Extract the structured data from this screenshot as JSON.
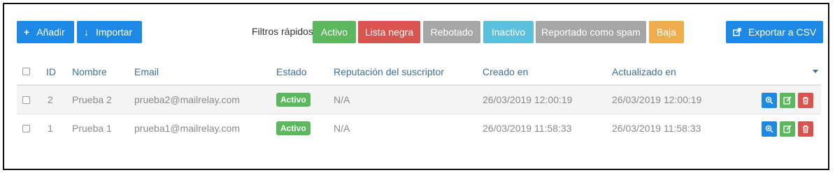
{
  "toolbar": {
    "add_label": "Añadir",
    "import_label": "Importar",
    "filters_label": "Filtros rápidos",
    "filters": [
      {
        "label": "Activo",
        "color": "#5cb85c"
      },
      {
        "label": "Lista negra",
        "color": "#d9534f"
      },
      {
        "label": "Rebotado",
        "color": "#a6a6a6"
      },
      {
        "label": "Inactivo",
        "color": "#5bc0de"
      },
      {
        "label": "Reportado como spam",
        "color": "#a6a6a6"
      },
      {
        "label": "Baja",
        "color": "#f0ad4e"
      }
    ],
    "export_label": "Exportar a CSV"
  },
  "table": {
    "headers": {
      "id": "ID",
      "name": "Nombre",
      "email": "Email",
      "status": "Estado",
      "reputation": "Reputación del suscriptor",
      "created": "Creado en",
      "updated": "Actualizado en"
    },
    "rows": [
      {
        "id": "2",
        "name": "Prueba 2",
        "email": "prueba2@mailrelay.com",
        "status": "Activo",
        "reputation": "N/A",
        "created": "26/03/2019 12:00:19",
        "updated": "26/03/2019 12:00:19"
      },
      {
        "id": "1",
        "name": "Prueba 1",
        "email": "prueba1@mailrelay.com",
        "status": "Activo",
        "reputation": "N/A",
        "created": "26/03/2019 11:58:33",
        "updated": "26/03/2019 11:58:33"
      }
    ]
  },
  "colors": {
    "primary": "#1e88e5",
    "active_badge": "#5cb85c",
    "view_action": "#1e88e5",
    "edit_action": "#5cb85c",
    "delete_action": "#d9534f"
  }
}
